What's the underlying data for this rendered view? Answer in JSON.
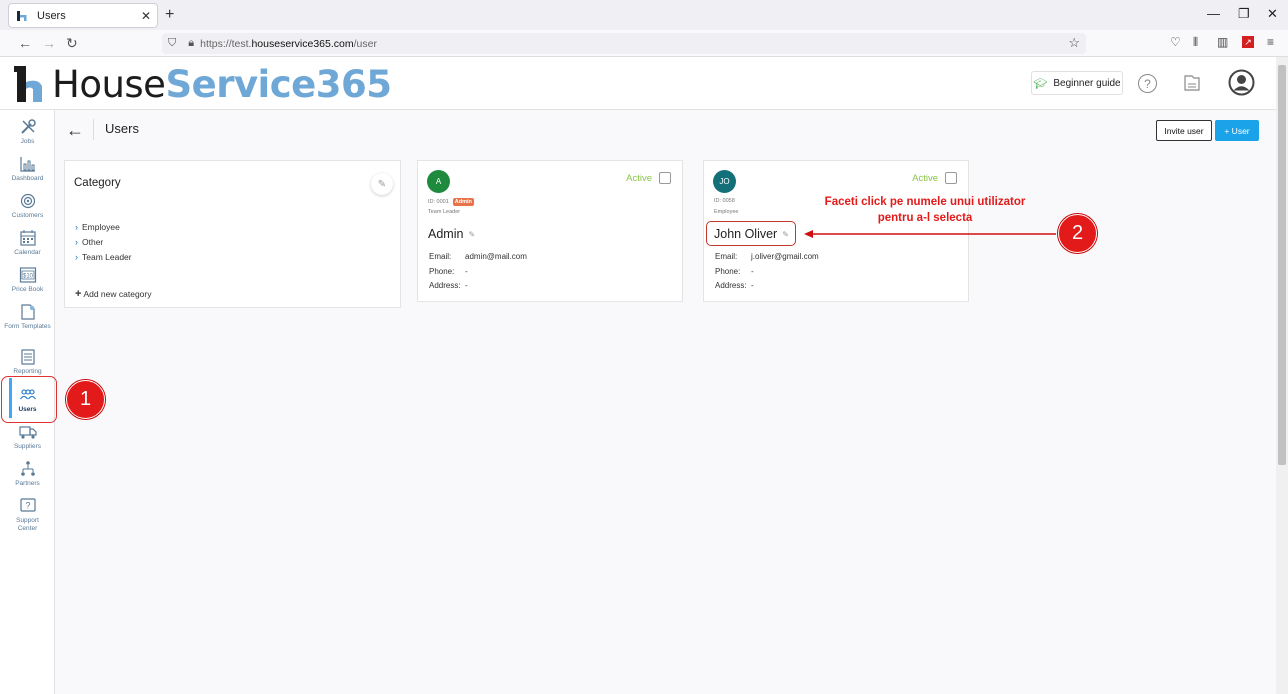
{
  "browser": {
    "tab_title": "Users",
    "url_prefix": "https://test.",
    "url_host": "houseservice365.com",
    "url_path": "/user"
  },
  "header": {
    "logo_part1": "House",
    "logo_part2": "Service365",
    "guide_label": "Beginner guide"
  },
  "sidebar": {
    "items": [
      {
        "label": "Jobs",
        "icon": "tools-icon"
      },
      {
        "label": "Dashboard",
        "icon": "chart-icon"
      },
      {
        "label": "Customers",
        "icon": "target-icon"
      },
      {
        "label": "Calendar",
        "icon": "calendar-icon"
      },
      {
        "label": "Price Book",
        "icon": "price-tag-icon"
      },
      {
        "label": "Form Templates",
        "icon": "form-icon"
      },
      {
        "label": "Reporting",
        "icon": "report-icon"
      },
      {
        "label": "Users",
        "icon": "users-icon"
      },
      {
        "label": "Suppliers",
        "icon": "truck-icon"
      },
      {
        "label": "Partners",
        "icon": "network-icon"
      },
      {
        "label": "Support Center",
        "icon": "help-box-icon"
      }
    ]
  },
  "page": {
    "title": "Users",
    "invite_label": "Invite user",
    "add_user_label": "+ User"
  },
  "category": {
    "title": "Category",
    "items": [
      "Employee",
      "Other",
      "Team Leader"
    ],
    "add_label": "Add new category"
  },
  "users": [
    {
      "initials": "A",
      "avatar_color": "#1e8a3e",
      "status": "Active",
      "id_text": "ID: 0001",
      "badge": "Admin",
      "role": "Team Leader",
      "name": "Admin",
      "email_label": "Email:",
      "email": "admin@mail.com",
      "phone_label": "Phone:",
      "phone": "-",
      "address_label": "Address:",
      "address": "-"
    },
    {
      "initials": "JO",
      "avatar_color": "#137079",
      "status": "Active",
      "id_text": "ID: 0058",
      "badge": "",
      "role": "Employee",
      "name": "John Oliver",
      "email_label": "Email:",
      "email": "j.oliver@gmail.com",
      "phone_label": "Phone:",
      "phone": "-",
      "address_label": "Address:",
      "address": "-"
    }
  ],
  "annotations": {
    "step1": "1",
    "step2": "2",
    "instruction_line1": "Faceti click pe numele unui utilizator",
    "instruction_line2": "pentru a-l selecta"
  }
}
